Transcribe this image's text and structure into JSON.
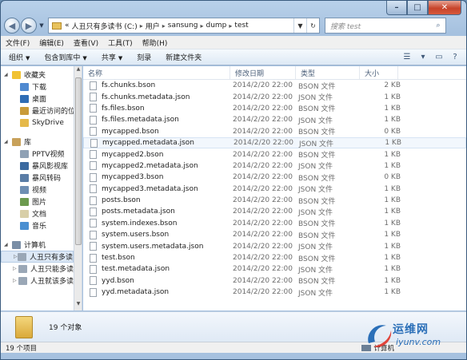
{
  "window": {
    "caption": {
      "minimize": "–",
      "maximize": "□",
      "close": "✕"
    }
  },
  "address": {
    "overflow": "«",
    "crumbs": [
      "人丑只有多读书 (C:)",
      "用户",
      "sansung",
      "dump",
      "test"
    ],
    "search_placeholder": "搜索 test"
  },
  "menu": [
    "文件(F)",
    "编辑(E)",
    "查看(V)",
    "工具(T)",
    "帮助(H)"
  ],
  "commands": [
    {
      "label": "组织",
      "dropdown": true
    },
    {
      "label": "包含到库中",
      "dropdown": true
    },
    {
      "label": "共享",
      "dropdown": true
    },
    {
      "label": "刻录",
      "dropdown": false
    },
    {
      "label": "新建文件夹",
      "dropdown": false
    }
  ],
  "nav": {
    "favorites": {
      "label": "收藏夹",
      "items": [
        "下载",
        "桌面",
        "最近访问的位",
        "SkyDrive"
      ]
    },
    "library": {
      "label": "库",
      "items": [
        "PPTV视频",
        "暴风影视库",
        "暴风转码",
        "视频",
        "图片",
        "文档",
        "音乐"
      ]
    },
    "computer": {
      "label": "计算机",
      "items": [
        "人丑只有多读",
        "人丑只能多读",
        "人丑就该多读"
      ]
    }
  },
  "columns": {
    "name": "名称",
    "date": "修改日期",
    "type": "类型",
    "size": "大小"
  },
  "files": [
    {
      "name": "fs.chunks.bson",
      "date": "2014/2/20 22:00",
      "type": "BSON 文件",
      "size": "2 KB"
    },
    {
      "name": "fs.chunks.metadata.json",
      "date": "2014/2/20 22:00",
      "type": "JSON 文件",
      "size": "1 KB"
    },
    {
      "name": "fs.files.bson",
      "date": "2014/2/20 22:00",
      "type": "BSON 文件",
      "size": "1 KB"
    },
    {
      "name": "fs.files.metadata.json",
      "date": "2014/2/20 22:00",
      "type": "JSON 文件",
      "size": "1 KB"
    },
    {
      "name": "mycapped.bson",
      "date": "2014/2/20 22:00",
      "type": "BSON 文件",
      "size": "0 KB"
    },
    {
      "name": "mycapped.metadata.json",
      "date": "2014/2/20 22:00",
      "type": "JSON 文件",
      "size": "1 KB"
    },
    {
      "name": "mycapped2.bson",
      "date": "2014/2/20 22:00",
      "type": "BSON 文件",
      "size": "1 KB"
    },
    {
      "name": "mycapped2.metadata.json",
      "date": "2014/2/20 22:00",
      "type": "JSON 文件",
      "size": "1 KB"
    },
    {
      "name": "mycapped3.bson",
      "date": "2014/2/20 22:00",
      "type": "BSON 文件",
      "size": "0 KB"
    },
    {
      "name": "mycapped3.metadata.json",
      "date": "2014/2/20 22:00",
      "type": "JSON 文件",
      "size": "1 KB"
    },
    {
      "name": "posts.bson",
      "date": "2014/2/20 22:00",
      "type": "BSON 文件",
      "size": "1 KB"
    },
    {
      "name": "posts.metadata.json",
      "date": "2014/2/20 22:00",
      "type": "JSON 文件",
      "size": "1 KB"
    },
    {
      "name": "system.indexes.bson",
      "date": "2014/2/20 22:00",
      "type": "BSON 文件",
      "size": "1 KB"
    },
    {
      "name": "system.users.bson",
      "date": "2014/2/20 22:00",
      "type": "BSON 文件",
      "size": "1 KB"
    },
    {
      "name": "system.users.metadata.json",
      "date": "2014/2/20 22:00",
      "type": "JSON 文件",
      "size": "1 KB"
    },
    {
      "name": "test.bson",
      "date": "2014/2/20 22:00",
      "type": "BSON 文件",
      "size": "1 KB"
    },
    {
      "name": "test.metadata.json",
      "date": "2014/2/20 22:00",
      "type": "JSON 文件",
      "size": "1 KB"
    },
    {
      "name": "yyd.bson",
      "date": "2014/2/20 22:00",
      "type": "BSON 文件",
      "size": "1 KB"
    },
    {
      "name": "yyd.metadata.json",
      "date": "2014/2/20 22:00",
      "type": "JSON 文件",
      "size": "1 KB"
    }
  ],
  "details": {
    "count": "19 个对象"
  },
  "status": {
    "items": "19 个项目",
    "location": "计算机"
  },
  "watermark": {
    "text": "运维网",
    "url": "iyunv.com"
  },
  "colors": {
    "accent": "#2b6fb8",
    "titlebar": "#b9d1ea"
  }
}
